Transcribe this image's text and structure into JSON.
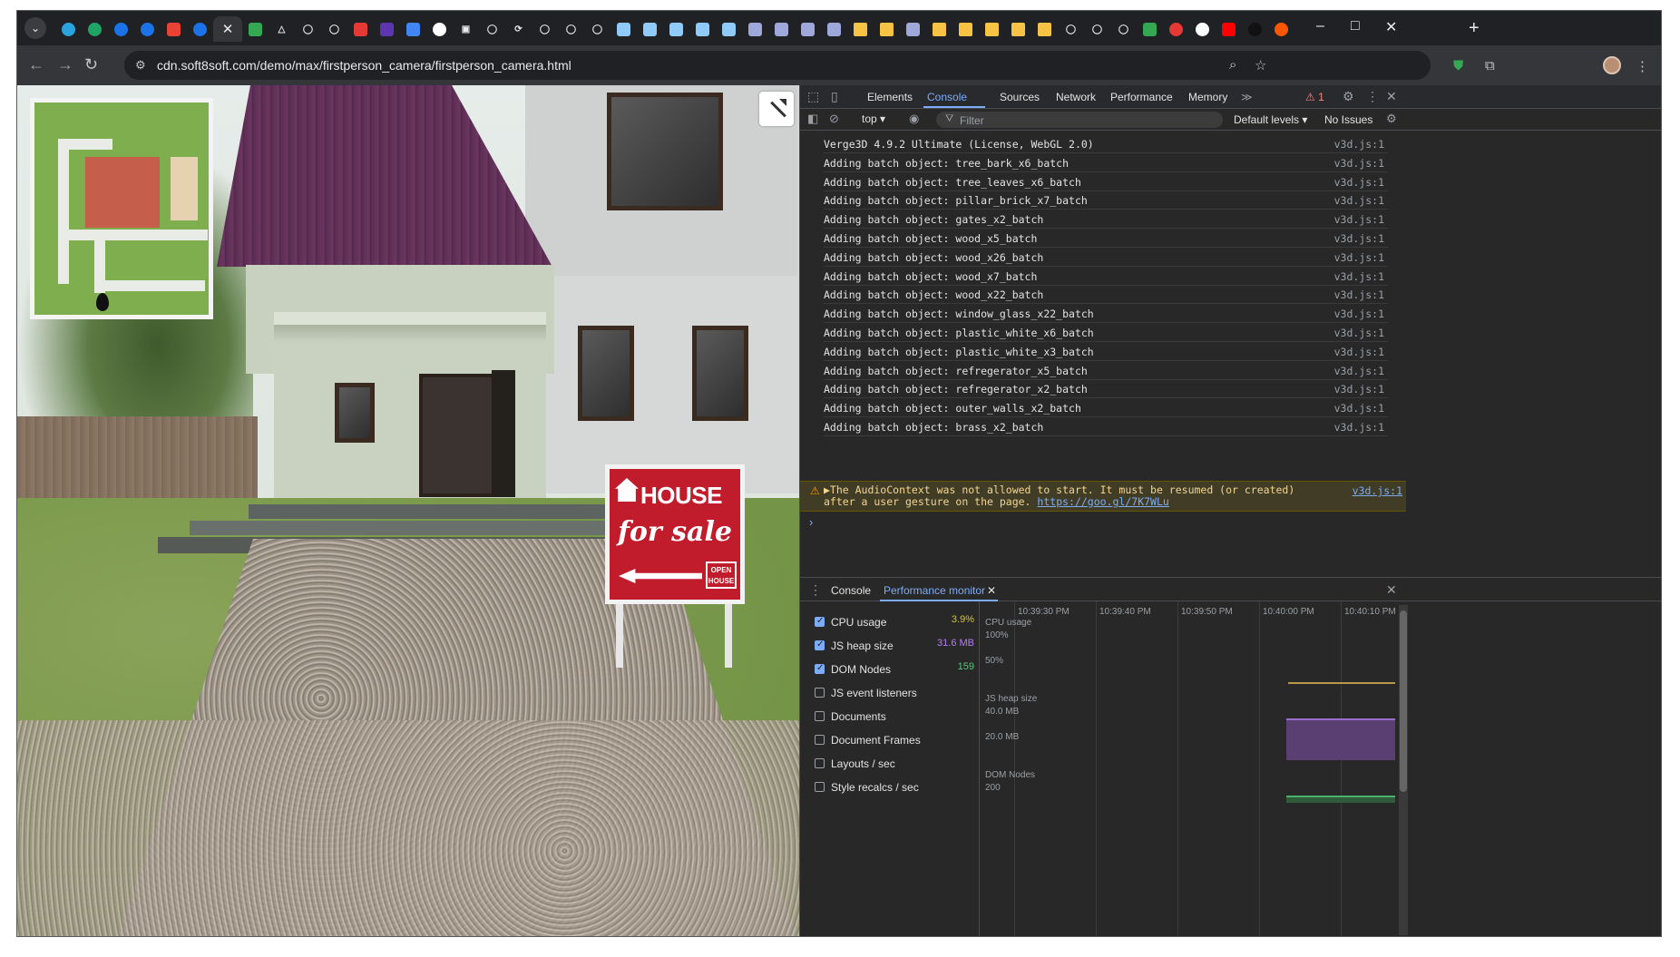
{
  "browser": {
    "url": "cdn.soft8soft.com/demo/max/firstperson_camera/firstperson_camera.html",
    "tab_favicons": [
      "telegram",
      "green-circle",
      "blue-shield",
      "blue-shield",
      "gmail",
      "blue-shield",
      "close",
      "ux",
      "triangle",
      "github",
      "github",
      "opera",
      "calendar",
      "dash",
      "google",
      "square",
      "github",
      "refresh",
      "github",
      "github",
      "github",
      "cube",
      "cube",
      "cube",
      "cube",
      "cube",
      "puzzle",
      "puzzle",
      "puzzle",
      "puzzle",
      "folder",
      "folder",
      "puzzle",
      "folder",
      "folder",
      "folder",
      "folder",
      "folder",
      "github",
      "github",
      "github",
      "drive",
      "red-circle",
      "google",
      "youtube",
      "dark",
      "reddit"
    ],
    "new_tab": "+",
    "window_controls": {
      "minimize": "–",
      "maximize": "□",
      "close": "✕"
    }
  },
  "viewport": {
    "sign": {
      "line1": "HOUSE",
      "line2": "for sale",
      "badge": "OPEN HOUSE"
    }
  },
  "devtools": {
    "tabs": [
      "Elements",
      "Console",
      "Sources",
      "Network",
      "Performance",
      "Memory"
    ],
    "active_tab": "Console",
    "more": "≫",
    "warning_count": "1",
    "context": "top",
    "filter_placeholder": "Filter",
    "levels": "Default levels",
    "issues": "No Issues",
    "logs": [
      {
        "msg": "Verge3D 4.9.2 Ultimate (License, WebGL 2.0)",
        "src": "v3d.js:1"
      },
      {
        "msg": "Adding batch object: tree_bark_x6_batch",
        "src": "v3d.js:1"
      },
      {
        "msg": "Adding batch object: tree_leaves_x6_batch",
        "src": "v3d.js:1"
      },
      {
        "msg": "Adding batch object: pillar_brick_x7_batch",
        "src": "v3d.js:1"
      },
      {
        "msg": "Adding batch object: gates_x2_batch",
        "src": "v3d.js:1"
      },
      {
        "msg": "Adding batch object: wood_x5_batch",
        "src": "v3d.js:1"
      },
      {
        "msg": "Adding batch object: wood_x26_batch",
        "src": "v3d.js:1"
      },
      {
        "msg": "Adding batch object: wood_x7_batch",
        "src": "v3d.js:1"
      },
      {
        "msg": "Adding batch object: wood_x22_batch",
        "src": "v3d.js:1"
      },
      {
        "msg": "Adding batch object: window_glass_x22_batch",
        "src": "v3d.js:1"
      },
      {
        "msg": "Adding batch object: plastic_white_x6_batch",
        "src": "v3d.js:1"
      },
      {
        "msg": "Adding batch object: plastic_white_x3_batch",
        "src": "v3d.js:1"
      },
      {
        "msg": "Adding batch object: refregerator_x5_batch",
        "src": "v3d.js:1"
      },
      {
        "msg": "Adding batch object: refregerator_x2_batch",
        "src": "v3d.js:1"
      },
      {
        "msg": "Adding batch object: outer_walls_x2_batch",
        "src": "v3d.js:1"
      },
      {
        "msg": "Adding batch object: brass_x2_batch",
        "src": "v3d.js:1"
      }
    ],
    "warning": {
      "msg": "▶The AudioContext was not allowed to start. It must be resumed (or created) after a user gesture on the page.",
      "link": "https://goo.gl/7K7WLu",
      "src": "v3d.js:1"
    },
    "prompt": "›",
    "drawer": {
      "tabs": [
        "Console",
        "Performance monitor"
      ],
      "active": "Performance monitor",
      "metrics": [
        {
          "label": "CPU usage",
          "checked": true,
          "value": "3.9%",
          "color": "#d8c23a"
        },
        {
          "label": "JS heap size",
          "checked": true,
          "value": "31.6 MB",
          "color": "#b57ef0"
        },
        {
          "label": "DOM Nodes",
          "checked": true,
          "value": "159",
          "color": "#5dc57a"
        },
        {
          "label": "JS event listeners",
          "checked": false,
          "value": "",
          "color": ""
        },
        {
          "label": "Documents",
          "checked": false,
          "value": "",
          "color": ""
        },
        {
          "label": "Document Frames",
          "checked": false,
          "value": "",
          "color": ""
        },
        {
          "label": "Layouts / sec",
          "checked": false,
          "value": "",
          "color": ""
        },
        {
          "label": "Style recalcs / sec",
          "checked": false,
          "value": "",
          "color": ""
        }
      ],
      "times": [
        "10:39:30 PM",
        "10:39:40 PM",
        "10:39:50 PM",
        "10:40:00 PM",
        "10:40:10 PM"
      ],
      "graph_labels": {
        "cpu": "CPU usage",
        "cpu_100": "100%",
        "cpu_50": "50%",
        "heap": "JS heap size",
        "heap_40": "40.0 MB",
        "heap_20": "20.0 MB",
        "dom": "DOM Nodes",
        "dom_200": "200"
      }
    }
  }
}
